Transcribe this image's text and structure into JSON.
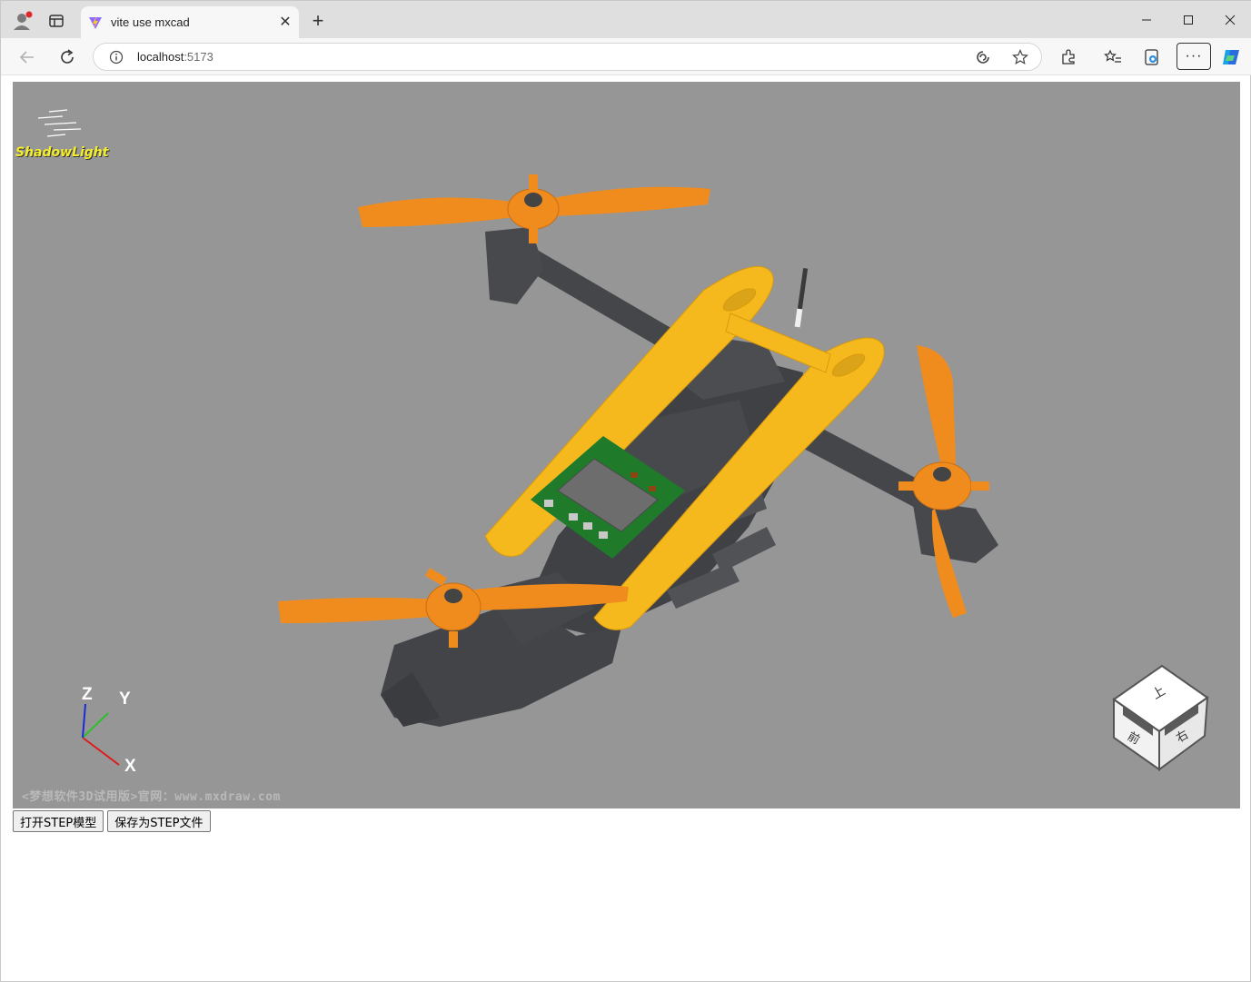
{
  "browser": {
    "tab_title": "vite use mxcad",
    "url_host": "localhost",
    "url_port": ":5173",
    "more_label": "···"
  },
  "viewer": {
    "logo_text": "ShadowLight",
    "axis_x": "X",
    "axis_y": "Y",
    "axis_z": "Z",
    "watermark": "<梦想软件3D试用版>官网：www.mxdraw.com",
    "viewcube_top": "上",
    "viewcube_front": "前",
    "viewcube_right": "右",
    "background_color": "#969696"
  },
  "buttons": {
    "open_step": "打开STEP模型",
    "save_step": "保存为STEP文件"
  },
  "colors": {
    "propeller": "#f08c1e",
    "frame": "#f5b91e",
    "body": "#4a4c50",
    "pcb": "#1f7a2a"
  }
}
